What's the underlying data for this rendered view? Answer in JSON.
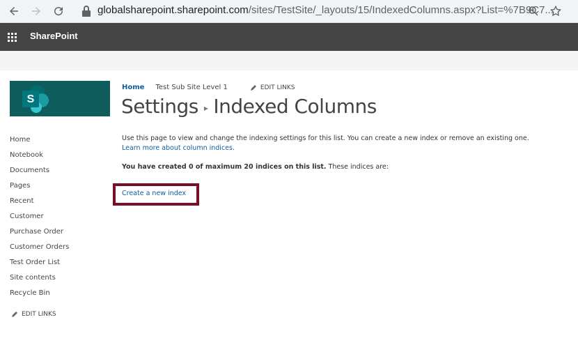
{
  "browser": {
    "url_host": "globalsharepoint.sharepoint.com",
    "url_path": "/sites/TestSite/_layouts/15/IndexedColumns.aspx?List=%7B9C7..."
  },
  "suite": {
    "title": "SharePoint"
  },
  "logo": {
    "letter": "S",
    "bg_color": "#0f5c5c",
    "accent": "#36a6a2"
  },
  "left_nav": {
    "items": [
      "Home",
      "Notebook",
      "Documents",
      "Pages",
      "Recent",
      "Customer",
      "Purchase Order",
      "Customer Orders",
      "Test Order List",
      "Site contents",
      "Recycle Bin"
    ],
    "edit_links": "EDIT LINKS"
  },
  "breadcrumb": {
    "home": "Home",
    "sub": "Test Sub Site Level 1",
    "edit_links": "EDIT LINKS"
  },
  "title": {
    "parent": "Settings",
    "current": "Indexed Columns"
  },
  "content": {
    "description": "Use this page to view and change the indexing settings for this list. You can create a new index or remove an existing one.",
    "learn_more": "Learn more about column indices.",
    "info_bold": "You have created 0 of maximum 20 indices on this list.",
    "info_rest": " These indices are:",
    "create_link": "Create a new index"
  },
  "colors": {
    "link": "#0f5c9e",
    "highlight_border": "#7a0e28"
  }
}
